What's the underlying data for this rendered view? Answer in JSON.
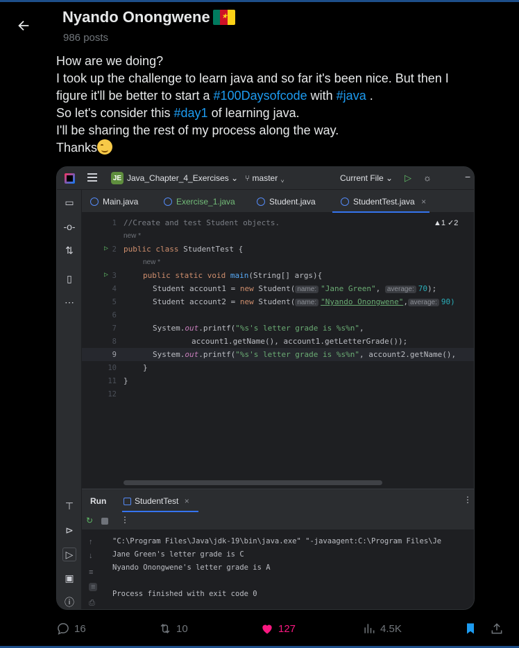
{
  "header": {
    "name": "Nyando Onongwene",
    "post_count": "986 posts",
    "flag_colors": [
      "#007a5e",
      "#ce1126",
      "#fcd116"
    ]
  },
  "tweet": {
    "line1": "How are we doing?",
    "line2": "I took up the challenge to learn java and so far it's been nice. But then I",
    "line3_pre": "figure it'll be better to start a ",
    "line3_tag1": "#100Daysofcode",
    "line3_mid": " with ",
    "line3_tag2": "#java",
    "line3_post": " .",
    "line4_pre": "So let's consider this ",
    "line4_tag": "#day1",
    "line4_post": " of learning java.",
    "line5": "I'll be sharing the rest of my process along the way.",
    "line6": "Thanks"
  },
  "ide": {
    "project_badge": "JE",
    "project_name": "Java_Chapter_4_Exercises ⌄",
    "branch": "master ⌄",
    "run_config": "Current File ⌄",
    "tabs": [
      "Main.java",
      "Exercise_1.java",
      "Student.java",
      "StudentTest.java"
    ],
    "tab_close": "×",
    "warnings": "▲1  ✓2",
    "line_numbers": [
      "1",
      "2",
      "3",
      "4",
      "5",
      "6",
      "7",
      "8",
      "9",
      "10",
      "11",
      "12"
    ],
    "code": {
      "l1": "//Create and test Student objects.",
      "new_hint": "new *",
      "l2_kw": "public class ",
      "l2_rest": "StudentTest {",
      "l3_kw": "public static void ",
      "l3_fn": "main",
      "l3_rest": "(String[] args){",
      "l4_a": "Student account1 = ",
      "l4_new": "new ",
      "l4_b": "Student(",
      "hint_name": "name:",
      "l4_str": "\"Jane Green\"",
      "hint_average": "average:",
      "l4_num": "70",
      "l4_end": ");",
      "l5_a": "Student account2 = ",
      "l5_b": "Student(",
      "l5_str": "\"Nyando Onongwene\"",
      "l5_num": "90)",
      "l7_a": "System.",
      "l7_out": "out",
      "l7_b": ".printf(",
      "l7_str": "\"%s's letter grade is %s%n\"",
      "l7_end": ",",
      "l8": "account1.getName(), account1.getLetterGrade());",
      "l9_str": "\"%s's letter grade is %s%n\"",
      "l9_end": ", account2.getName(),",
      "l10": "}",
      "l11": "}"
    },
    "run": {
      "title": "Run",
      "tab": "StudentTest",
      "console_cmd": "\"C:\\Program Files\\Java\\jdk-19\\bin\\java.exe\" \"-javaagent:C:\\Program Files\\Je",
      "out1": "Jane Green's letter grade is C",
      "out2": "Nyando Onongwene's letter grade is A",
      "out3": "Process finished with exit code 0"
    }
  },
  "actions": {
    "replies": "16",
    "reposts": "10",
    "likes": "127",
    "views": "4.5K",
    "like_color": "#f91880",
    "bookmark_color": "#1d9bf0"
  }
}
